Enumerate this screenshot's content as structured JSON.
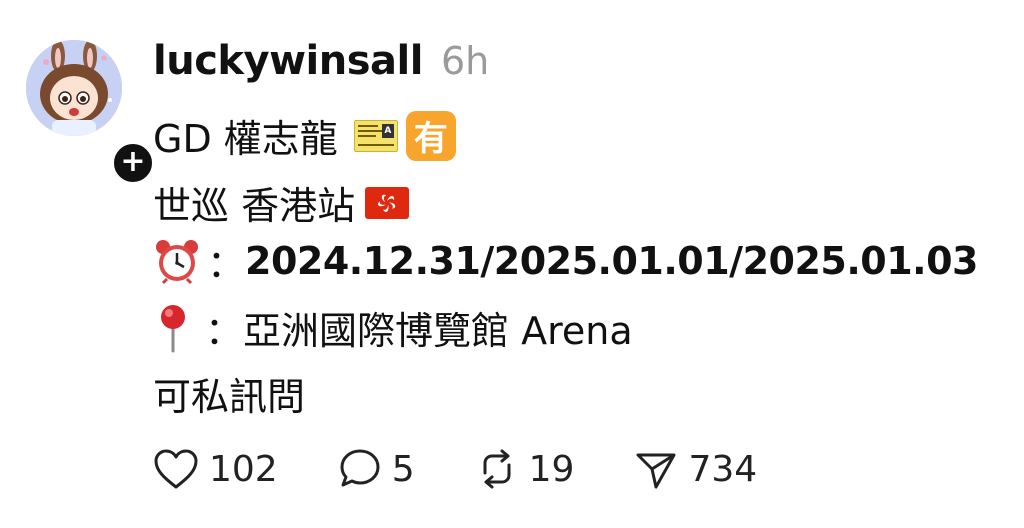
{
  "post": {
    "author": {
      "username": "luckywinsall",
      "timestamp": "6h"
    },
    "lines": {
      "line1": "GD 權志龍",
      "line2": "世巡 香港站",
      "line3_prefix": "：",
      "line3_dates": "2024.12.31/2025.01.01/2025.01.03",
      "line4_prefix": "：",
      "line4_venue": "亞洲國際博覽館 Arena",
      "line5": "可私訊問"
    },
    "emoji_badge_text": "有",
    "icons": [
      "ticket-icon",
      "you-badge-icon",
      "hk-flag-icon",
      "alarm-clock-icon",
      "round-pushpin-icon"
    ],
    "stats": {
      "likes": "102",
      "replies": "5",
      "reposts": "19",
      "shares": "734"
    }
  },
  "colors": {
    "text": "#111111",
    "muted": "#9a9a9a",
    "accent_badge": "#f7a52c",
    "flag_red": "#de2910"
  }
}
